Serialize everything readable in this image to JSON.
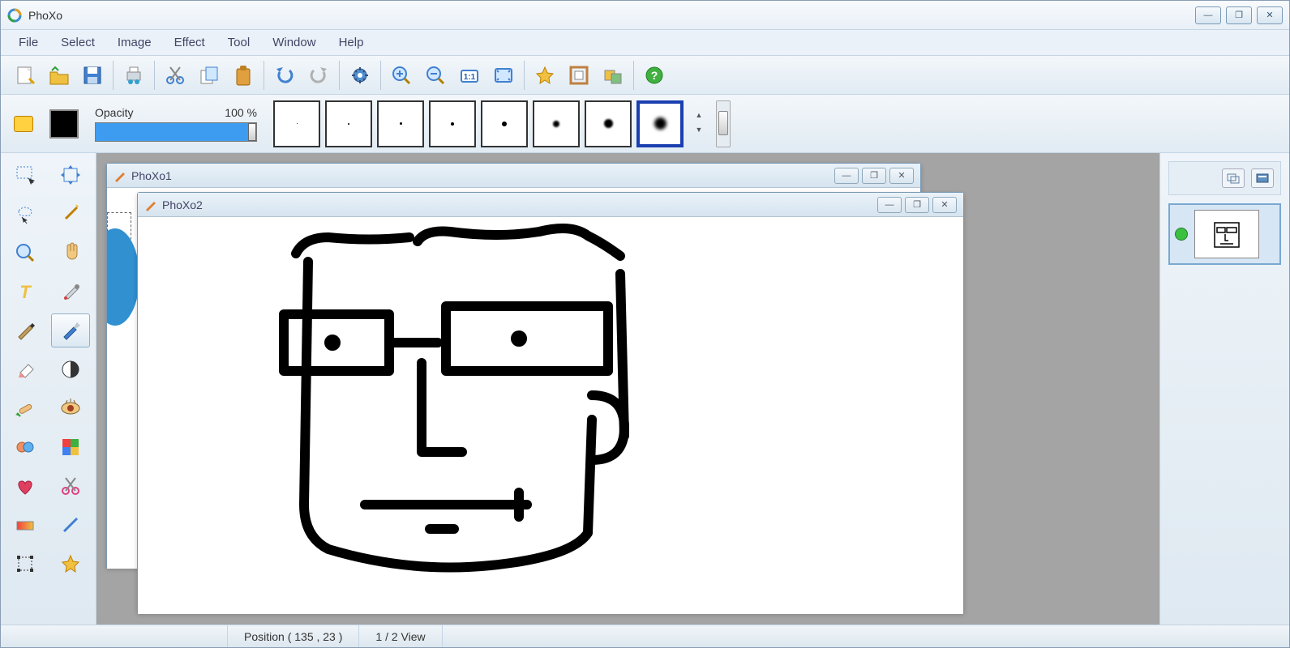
{
  "app": {
    "title": "PhoXo"
  },
  "window_controls": {
    "minimize": "—",
    "maximize": "❐",
    "close": "✕"
  },
  "menu": {
    "file": "File",
    "select": "Select",
    "image": "Image",
    "effect": "Effect",
    "tool": "Tool",
    "window": "Window",
    "help": "Help"
  },
  "toolbar": {
    "new": "New",
    "open": "Open",
    "save": "Save",
    "print": "Print",
    "cut": "Cut",
    "copy": "Copy",
    "paste": "Paste",
    "undo": "Undo",
    "redo": "Redo",
    "settings": "Settings",
    "zoomin": "Zoom In",
    "zoomout": "Zoom Out",
    "actual": "1:1",
    "fit": "Fit",
    "fav": "Favorite",
    "frame": "Frame",
    "layers": "Layers",
    "help": "Help"
  },
  "options": {
    "opacity_label": "Opacity",
    "opacity_value": "100 %",
    "color": "#000000",
    "brush_sizes": [
      1,
      2,
      3,
      4,
      5,
      7,
      10,
      14
    ],
    "selected_brush_index": 7
  },
  "toolbox": {
    "rect_select": "Rectangle Select",
    "move": "Move",
    "lasso": "Lasso",
    "wand": "Magic Wand",
    "zoom": "Zoom",
    "hand": "Hand",
    "text": "Text",
    "picker": "Color Picker",
    "pen": "Pen",
    "brush": "Brush",
    "eraser": "Eraser",
    "contrast": "Contrast",
    "heal": "Heal",
    "redeye": "Red Eye",
    "clone": "Clone",
    "puzzle": "Puzzle",
    "heart": "Heart Stamp",
    "scissors": "Scissors",
    "gradient": "Gradient",
    "line": "Line",
    "transform": "Transform",
    "star": "Star"
  },
  "documents": {
    "doc1": {
      "title": "PhoXo1"
    },
    "doc2": {
      "title": "PhoXo2"
    }
  },
  "right": {
    "layers_btn": "Layers",
    "help_btn": "Info"
  },
  "status": {
    "position": "Position ( 135 , 23 )",
    "view": "1 / 2 View"
  }
}
